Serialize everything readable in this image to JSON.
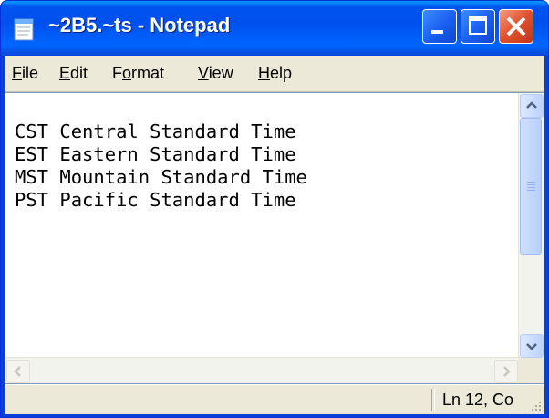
{
  "window": {
    "title": "~2B5.~ts - Notepad"
  },
  "menu": {
    "items": [
      {
        "label": "File",
        "mnemonic": "F"
      },
      {
        "label": "Edit",
        "mnemonic": "E"
      },
      {
        "label": "Format",
        "mnemonic": "o"
      },
      {
        "label": "View",
        "mnemonic": "V"
      },
      {
        "label": "Help",
        "mnemonic": "H"
      }
    ]
  },
  "editor": {
    "lines": [
      "CST Central Standard Time",
      "EST Eastern Standard Time",
      "MST Mountain Standard Time",
      "PST Pacific Standard Time"
    ]
  },
  "status": {
    "position": "Ln 12, Co"
  },
  "icons": {
    "app": "notepad-icon",
    "minimize": "minimize-icon",
    "maximize": "maximize-icon",
    "close": "close-icon",
    "scroll_up": "arrow-up-icon",
    "scroll_down": "arrow-down-icon",
    "scroll_left": "arrow-left-icon",
    "scroll_right": "arrow-right-icon",
    "size_grip": "size-grip-icon"
  },
  "colors": {
    "titlebar": "#0053ee",
    "close_button": "#e0502a",
    "chrome": "#ece9d8"
  }
}
